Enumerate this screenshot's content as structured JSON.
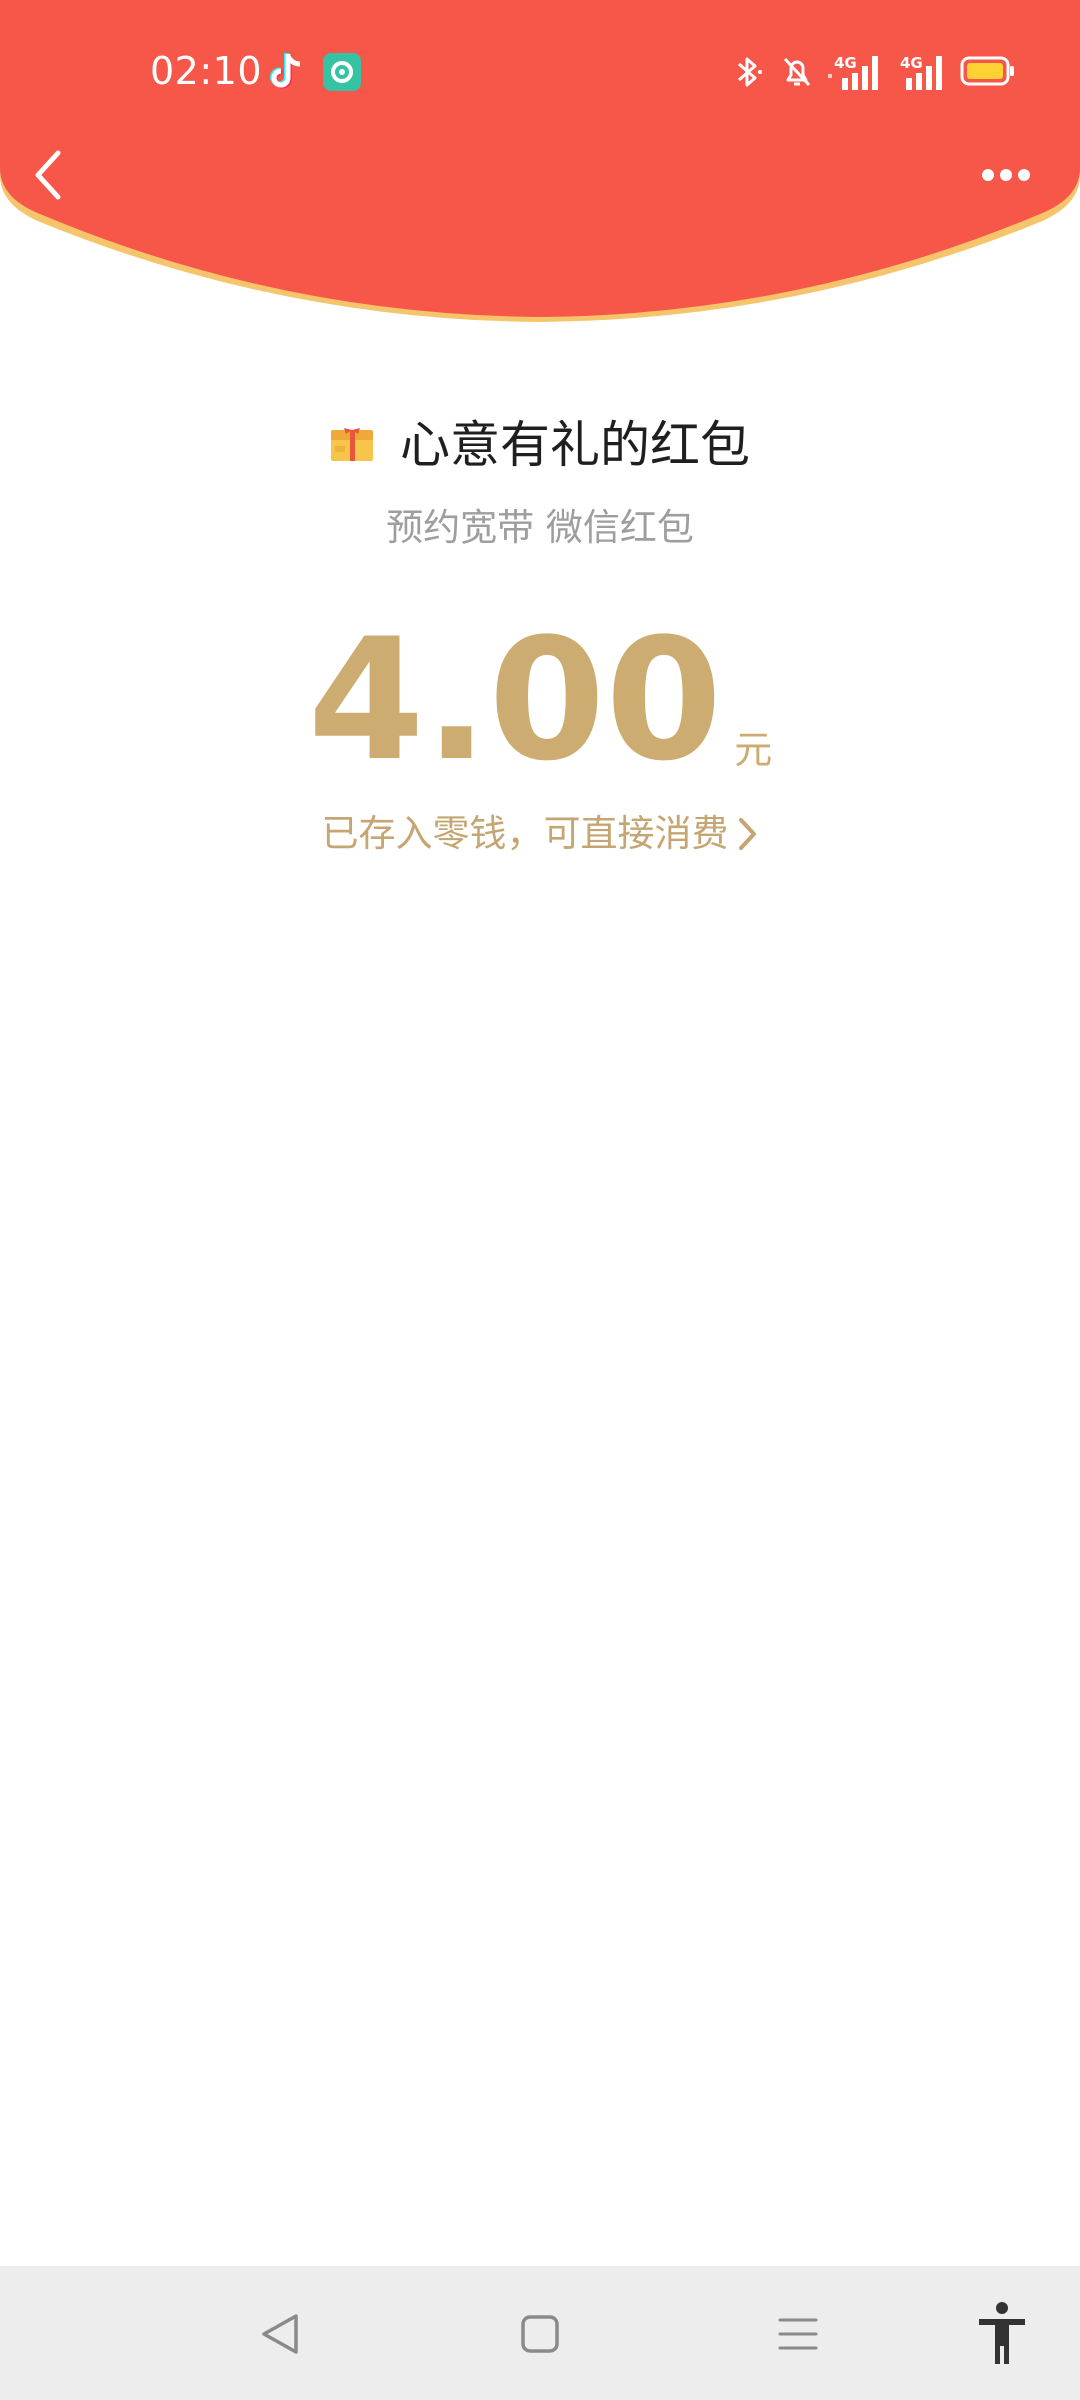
{
  "status_bar": {
    "time": "02:10",
    "icons": [
      "tiktok-icon",
      "app-icon",
      "bluetooth-icon",
      "bell-off-icon",
      "signal-4g-icon",
      "signal-4g-icon",
      "battery-icon"
    ],
    "network_label_1": "4G",
    "network_label_2": "4G"
  },
  "header": {
    "background_color": "#f65749",
    "rim_color": "#f6c46a"
  },
  "nav": {
    "back_icon": "chevron-left-icon",
    "more_icon": "more-horizontal-icon"
  },
  "red_packet": {
    "title": "心意有礼的红包",
    "subtitle": "预约宽带 微信红包",
    "amount": "4.00",
    "unit": "元",
    "deposit_text": "已存入零钱，可直接消费",
    "accent_color": "#cdac71"
  },
  "system_nav": {
    "buttons": [
      "back-triangle-icon",
      "home-square-icon",
      "recent-menu-icon",
      "accessibility-icon"
    ]
  }
}
